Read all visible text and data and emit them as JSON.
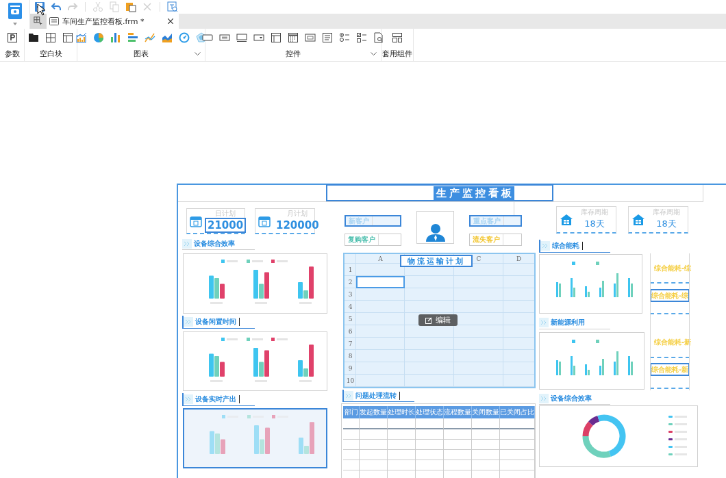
{
  "toolbar": {
    "groups": [
      {
        "actions": [
          {
            "kind": "save",
            "disabled": false
          },
          {
            "kind": "undo",
            "disabled": false
          },
          {
            "kind": "redo",
            "disabled": true
          }
        ]
      },
      {
        "actions": [
          {
            "kind": "cut",
            "disabled": true
          },
          {
            "kind": "copy",
            "disabled": true
          },
          {
            "kind": "paste",
            "disabled": false
          },
          {
            "kind": "delete",
            "disabled": true
          }
        ]
      },
      {
        "actions": [
          {
            "kind": "preview",
            "disabled": false
          }
        ]
      }
    ]
  },
  "tabs": [
    {
      "label": "车间生产监控看板.frm *",
      "selected": true
    }
  ],
  "ribbon": {
    "groups": [
      {
        "label": "参数",
        "dropdown": false,
        "tools": [
          {
            "kind": "param"
          }
        ]
      },
      {
        "label": "空白块",
        "dropdown": false,
        "tools": [
          {
            "kind": "block-solid"
          },
          {
            "kind": "block-split"
          },
          {
            "kind": "block-layout"
          }
        ]
      },
      {
        "label": "图表",
        "dropdown": true,
        "tools": [
          {
            "kind": "chart-combo"
          },
          {
            "kind": "chart-pie"
          },
          {
            "kind": "chart-bar"
          },
          {
            "kind": "chart-hbar"
          },
          {
            "kind": "chart-line"
          },
          {
            "kind": "chart-area"
          },
          {
            "kind": "chart-gauge"
          },
          {
            "kind": "chart-radar"
          }
        ]
      },
      {
        "label": "控件",
        "dropdown": true,
        "tools": [
          {
            "kind": "ctrl-button"
          },
          {
            "kind": "ctrl-label"
          },
          {
            "kind": "ctrl-input"
          },
          {
            "kind": "ctrl-select"
          },
          {
            "kind": "ctrl-panel"
          },
          {
            "kind": "ctrl-date"
          },
          {
            "kind": "ctrl-number"
          },
          {
            "kind": "ctrl-list"
          },
          {
            "kind": "ctrl-radio"
          },
          {
            "kind": "ctrl-check"
          },
          {
            "kind": "ctrl-search"
          }
        ]
      },
      {
        "label": "套用组件",
        "dropdown": false,
        "tools": [
          {
            "kind": "template"
          }
        ]
      }
    ]
  },
  "dashboard": {
    "title": "生产监控看板",
    "plan_cards": [
      {
        "label": "日计划",
        "value": "21000",
        "selected": true
      },
      {
        "label": "月计划",
        "value": "120000",
        "selected": false
      }
    ],
    "customer_fields": [
      {
        "label": "新客户",
        "color": "#a6d3f2",
        "selected": true
      },
      {
        "label": "复购客户",
        "color": "#4cbfae",
        "selected": false
      },
      {
        "label": "重点客户",
        "color": "#a6d3f2",
        "selected": true
      },
      {
        "label": "流失客户",
        "color": "#f2c42a",
        "selected": false
      }
    ],
    "inventory_cards": [
      {
        "label": "库存周期",
        "value": "18天"
      },
      {
        "label": "库存周期",
        "value": "18天"
      }
    ],
    "section_titles": [
      {
        "label": "设备综合效率",
        "selected": false
      },
      {
        "label": "设备闲置时间",
        "selected": true
      },
      {
        "label": "设备实时产出",
        "selected": true
      },
      {
        "label": "问题处理流转",
        "selected": true
      },
      {
        "label": "综合能耗",
        "selected": true
      },
      {
        "label": "新能源利用",
        "selected": false
      },
      {
        "label": "设备综合效率",
        "selected": false
      }
    ],
    "bar_charts": [
      {
        "selected": false
      },
      {
        "selected": false
      },
      {
        "selected": true
      }
    ],
    "spreadsheet": {
      "title": "物流运输计划",
      "columns": [
        "A",
        "C",
        "D"
      ],
      "edit_button": "编辑",
      "rows": [
        {
          "label": "1",
          "selected": false
        },
        {
          "label": "2",
          "selected": true
        },
        {
          "label": "3",
          "selected": false
        },
        {
          "label": "4",
          "selected": false
        },
        {
          "label": "5",
          "selected": false
        },
        {
          "label": "6",
          "selected": false
        },
        {
          "label": "7",
          "selected": false
        },
        {
          "label": "8",
          "selected": false
        },
        {
          "label": "9",
          "selected": false
        },
        {
          "label": "10",
          "selected": false
        }
      ]
    },
    "table": {
      "columns": [
        "部门",
        "发起数量",
        "处理时长",
        "处理状态",
        "流程数量",
        "关闭数量",
        "已关闭占比"
      ]
    },
    "energy_labels": [
      {
        "label": "综合能耗-综",
        "selected": false
      },
      {
        "label": "综合能耗-综",
        "selected": true
      },
      {
        "label": "综合能耗-新",
        "selected": false
      },
      {
        "label": "综合能耗-新",
        "selected": true
      }
    ]
  }
}
